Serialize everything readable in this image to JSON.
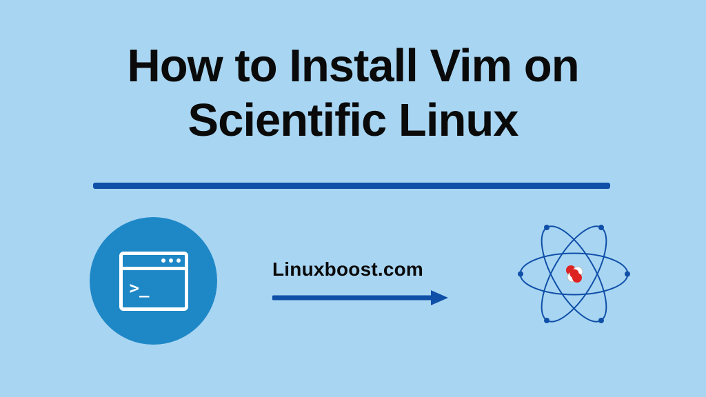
{
  "title_line1": "How to Install Vim on",
  "title_line2": "Scientific Linux",
  "site_label": "Linuxboost.com",
  "terminal_prompt": ">_",
  "colors": {
    "background": "#a8d5f2",
    "accent_blue": "#0f4fa8",
    "circle_blue": "#1e88c7",
    "text_dark": "#0a0a0a",
    "nucleus_red": "#d22",
    "nucleus_white": "#fff"
  }
}
